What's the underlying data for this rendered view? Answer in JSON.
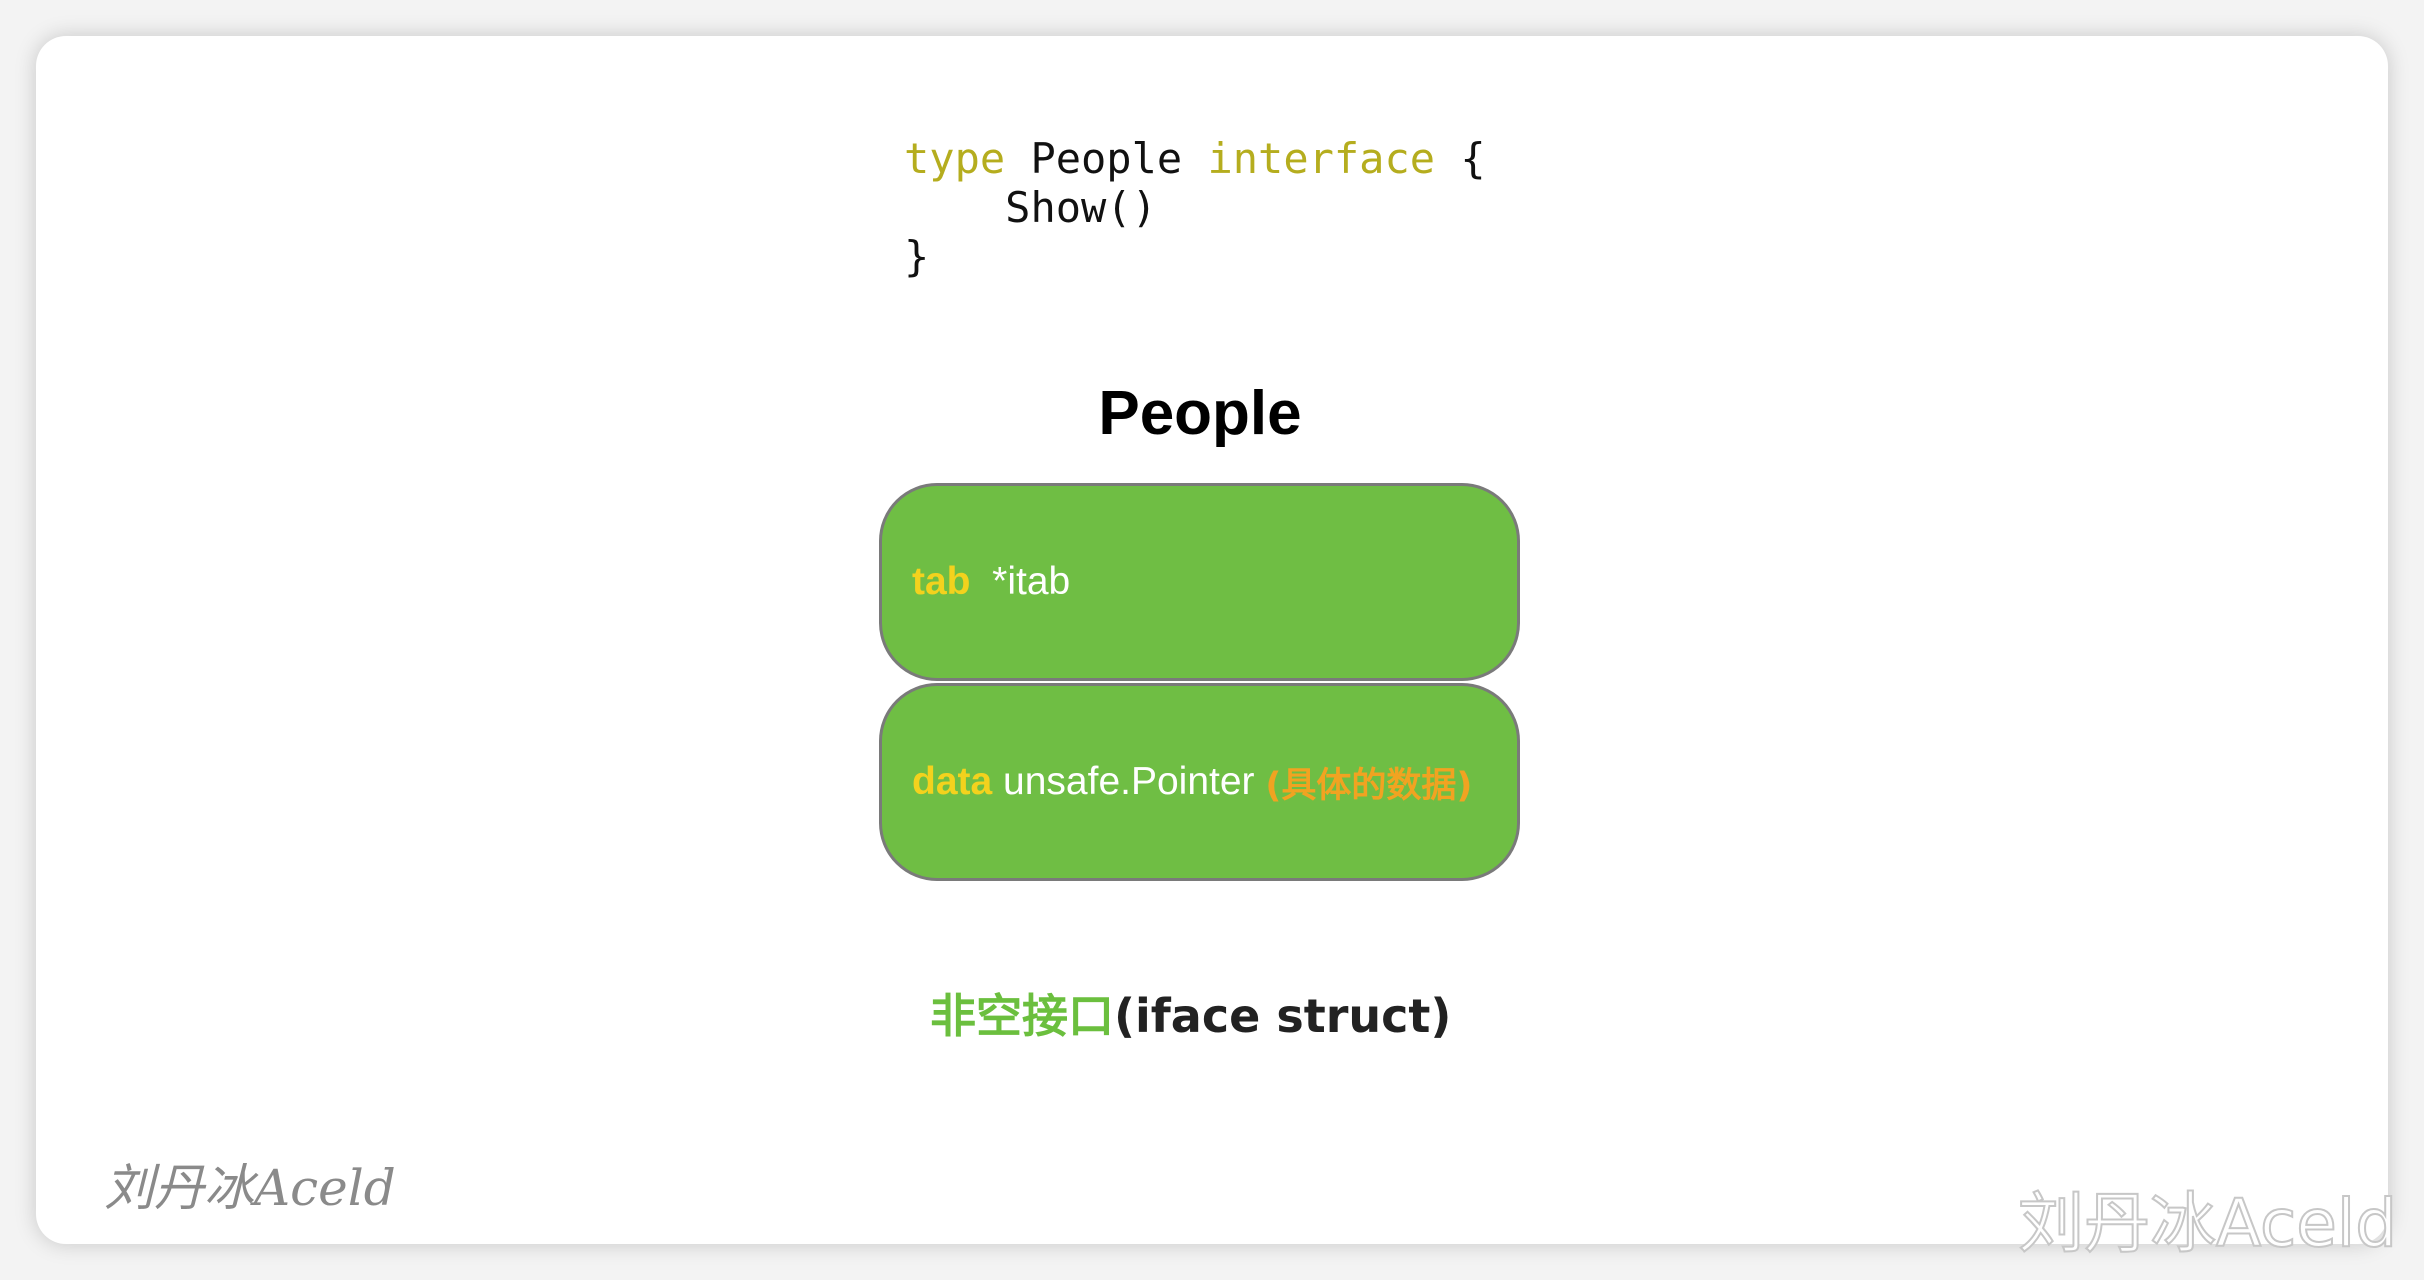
{
  "code": {
    "line1": {
      "kw1": "type",
      "name": "People",
      "kw2": "interface",
      "brace": "{"
    },
    "line2": "Show()",
    "line3": "}"
  },
  "diagram": {
    "title": "People",
    "fields": [
      {
        "name": "tab",
        "type": "*itab",
        "note": ""
      },
      {
        "name": "data",
        "type": "unsafe.Pointer",
        "note": "(具体的数据)"
      }
    ],
    "caption": {
      "cn": "非空接口",
      "en": "(iface struct)"
    }
  },
  "watermarks": {
    "left": "刘丹冰Aceld",
    "right": "刘丹冰Aceld"
  },
  "colors": {
    "keyword": "#b5ad1e",
    "box_fill": "#6fbe44",
    "field_name": "#f3d21d",
    "note": "#f1a321",
    "caption_cn": "#6bbf3e"
  }
}
